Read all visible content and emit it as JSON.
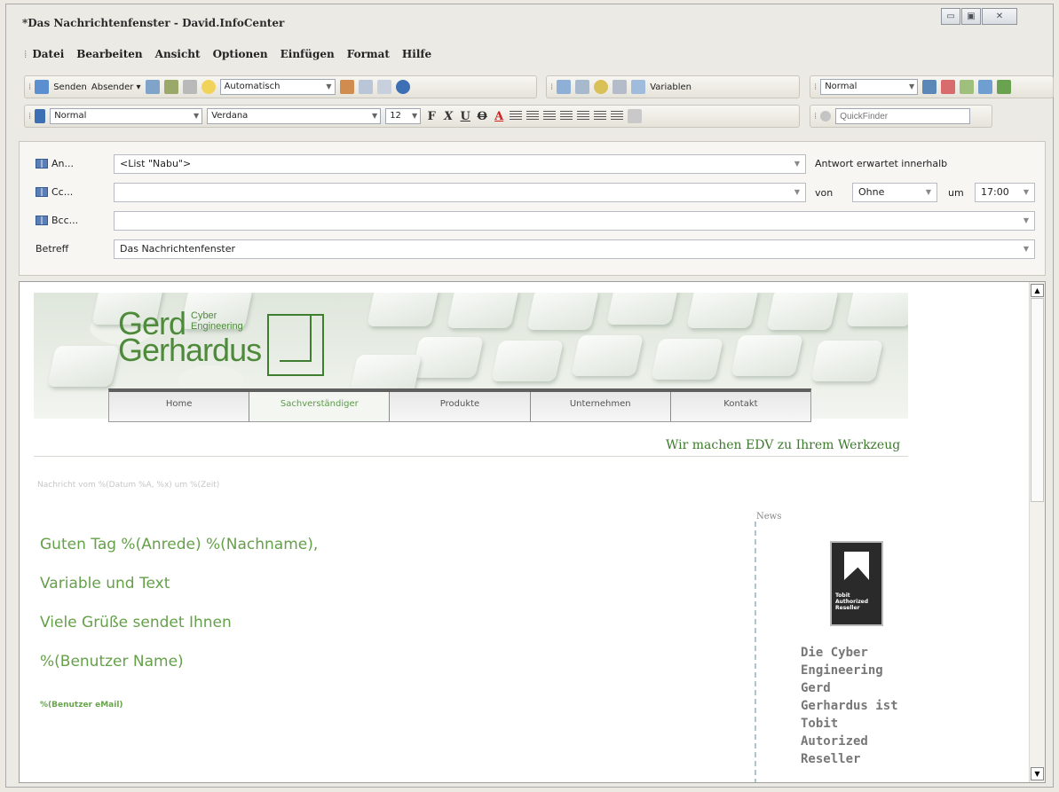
{
  "window": {
    "title": "*Das Nachrichtenfenster - David.InfoCenter",
    "controls": [
      "minimize",
      "maximize",
      "close"
    ]
  },
  "menu": [
    "Datei",
    "Bearbeiten",
    "Ansicht",
    "Optionen",
    "Einfügen",
    "Format",
    "Hilfe"
  ],
  "toolbar1": {
    "send": "Senden",
    "sender": "Absender",
    "priority": "Automatisch",
    "variables": "Variablen",
    "style": "Normal"
  },
  "toolbar2": {
    "paragraph_style": "Normal",
    "font": "Verdana",
    "size": "12",
    "quickfinder_placeholder": "QuickFinder"
  },
  "header": {
    "to_label": "An...",
    "to_value": "<List \"Nabu\">",
    "cc_label": "Cc...",
    "cc_value": "",
    "bcc_label": "Bcc...",
    "bcc_value": "",
    "subject_label": "Betreff",
    "subject_value": "Das Nachrichtenfenster",
    "reply_label": "Antwort erwartet innerhalb",
    "from_label": "von",
    "from_value": "Ohne",
    "at_label": "um",
    "time_value": "17:00"
  },
  "banner": {
    "logo_gerd": "Gerd",
    "logo_gerhardus": "Gerhardus",
    "logo_cyber": "Cyber",
    "logo_engineering": "Engineering",
    "nav": [
      "Home",
      "Sachverständiger",
      "Produkte",
      "Unternehmen",
      "Kontakt"
    ],
    "active_nav": "Sachverständiger",
    "slogan": "Wir machen EDV zu Ihrem Werkzeug"
  },
  "body": {
    "message_date": "Nachricht vom %(Datum %A, %x) um %(Zeit)",
    "greeting": "Guten Tag %(Anrede) %(Nachname),",
    "line2": "Variable und Text",
    "line3": "Viele Grüße sendet Ihnen",
    "user_name": "%(Benutzer Name)",
    "user_email": "%(Benutzer eMail)"
  },
  "sidebar": {
    "news_label": "News",
    "badge_text": "Tobit Authorized Reseller",
    "reseller_lines": [
      "Die Cyber",
      "Engineering",
      "Gerd",
      "Gerhardus ist",
      "Tobit",
      "Autorized",
      "Reseller"
    ]
  },
  "colors": {
    "green_text": "#65a04a",
    "dark_green": "#3c7a2c",
    "window_bg": "#eceae4"
  }
}
